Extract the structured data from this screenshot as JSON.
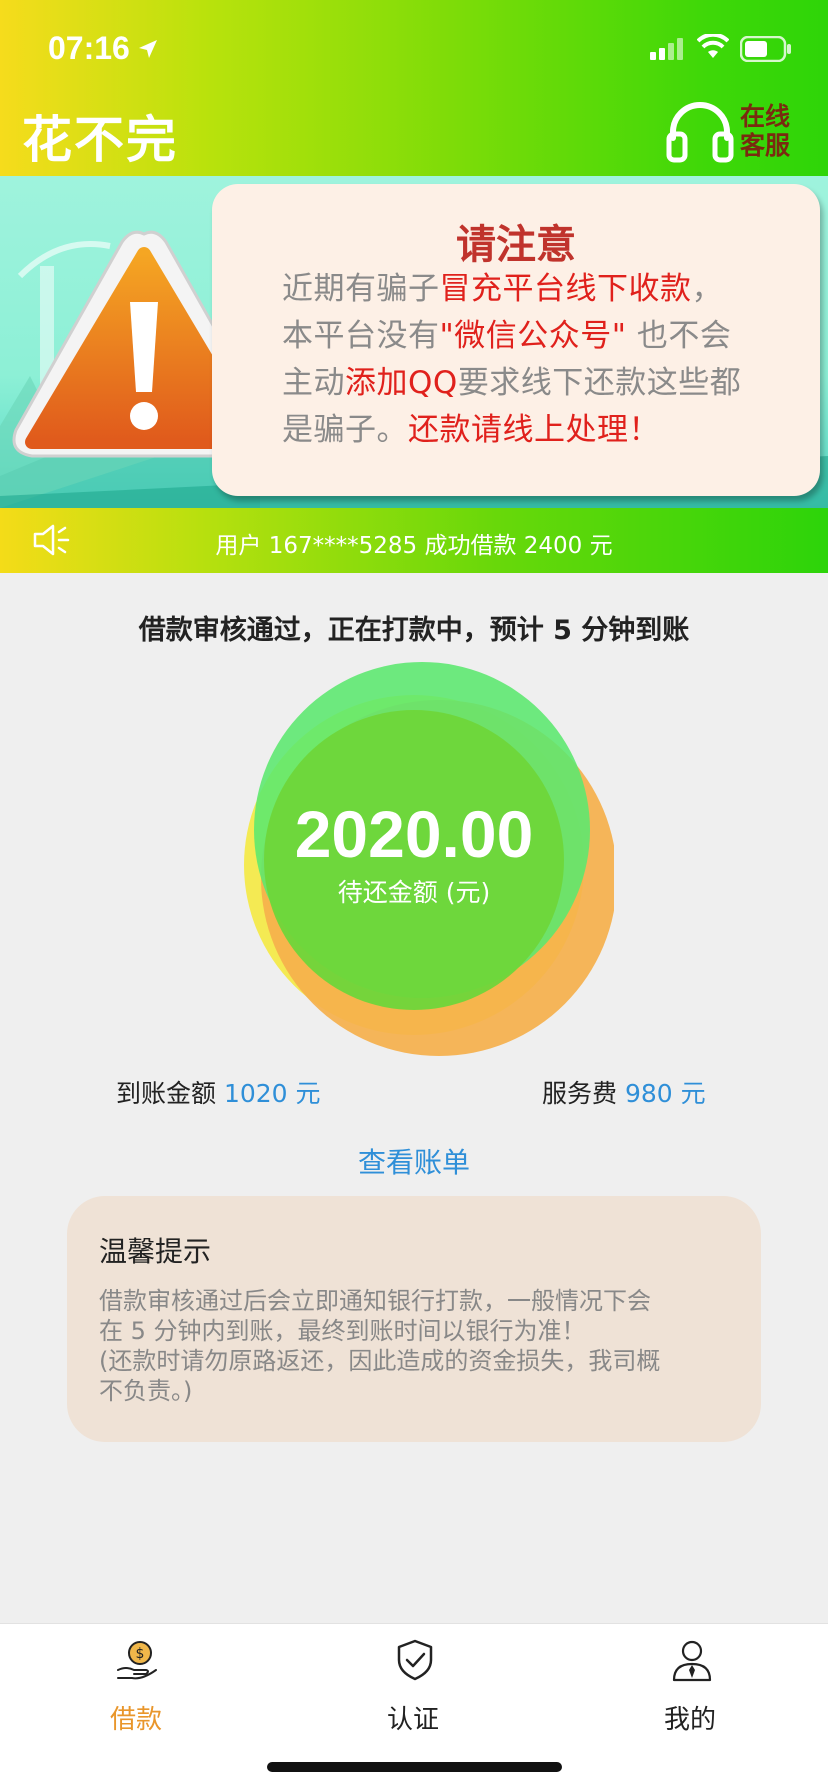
{
  "status_bar": {
    "time": "07:16"
  },
  "header": {
    "app_title": "花不完",
    "service_line1": "在线",
    "service_line2": "客服"
  },
  "notice": {
    "title": "请注意",
    "line1_a": "近期有骗子",
    "line1_b": "冒充平台线下收款",
    "line1_c": "，",
    "line2_a": "本平台没有",
    "line2_b": "\"微信公众号\"",
    "line2_c": " 也不会",
    "line3_a": "主动",
    "line3_b": "添加QQ",
    "line3_c": "要求线下还款这些都",
    "line4_a": "是骗子。",
    "line4_b": "还款请线上处理！"
  },
  "ticker": {
    "text": "用户 167****5285 成功借款 2400 元"
  },
  "loan": {
    "status_message": "借款审核通过，正在打款中，预计 5 分钟到账",
    "amount": "2020.00",
    "amount_label": "待还金额 (元)",
    "arrival_label": "到账金额",
    "arrival_value": "1020 元",
    "fee_label": "服务费",
    "fee_value": "980 元",
    "view_bill": "查看账单"
  },
  "tips": {
    "title": "温馨提示",
    "line1": "借款审核通过后会立即通知银行打款，一般情况下会",
    "line2": "在 5 分钟内到账，最终到账时间以银行为准！",
    "line3": "(还款时请勿原路返还，因此造成的资金损失，我司概",
    "line4": "不负责。)"
  },
  "tabs": [
    {
      "label": "借款",
      "icon": "money-hand-icon",
      "active": true
    },
    {
      "label": "认证",
      "icon": "shield-check-icon",
      "active": false
    },
    {
      "label": "我的",
      "icon": "person-icon",
      "active": false
    }
  ],
  "colors": {
    "accent_blue": "#2f8fd8",
    "active_tab": "#e9962b",
    "warning_red": "#e0211c",
    "header_green": "#2ed508",
    "header_yellow": "#f6dc1c"
  }
}
